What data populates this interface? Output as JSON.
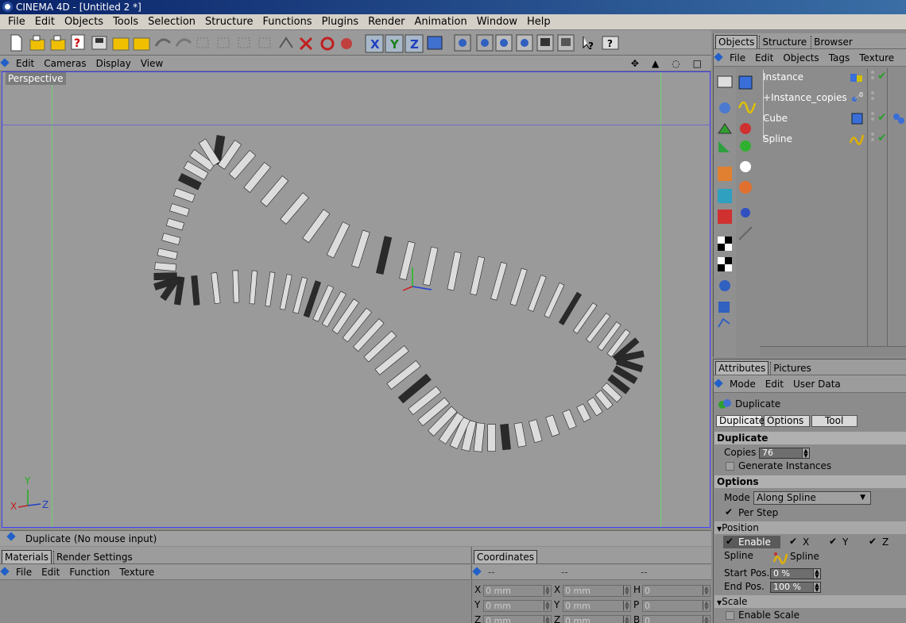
{
  "window": {
    "title": "CINEMA 4D - [Untitled 2 *]"
  },
  "menu": [
    "File",
    "Edit",
    "Objects",
    "Tools",
    "Selection",
    "Structure",
    "Functions",
    "Plugins",
    "Render",
    "Animation",
    "Window",
    "Help"
  ],
  "viewport": {
    "menu": [
      "Edit",
      "Cameras",
      "Display",
      "View"
    ],
    "label": "Perspective",
    "axis_labels": {
      "y": "Y",
      "x": "X",
      "z": "Z"
    }
  },
  "status": {
    "text": "Duplicate (No mouse input)"
  },
  "materials": {
    "tab_active": "Materials",
    "tab_other": "Render Settings",
    "menu": [
      "File",
      "Edit",
      "Function",
      "Texture"
    ]
  },
  "coordinates": {
    "tab": "Coordinates",
    "header": [
      "--",
      "--",
      "--"
    ],
    "rows": [
      {
        "a": "X",
        "av": "0 mm",
        "b": "X",
        "bv": "0 mm",
        "c": "H",
        "cv": "0"
      },
      {
        "a": "Y",
        "av": "0 mm",
        "b": "Y",
        "bv": "0 mm",
        "c": "P",
        "cv": "0"
      },
      {
        "a": "Z",
        "av": "0 mm",
        "b": "Z",
        "bv": "0 mm",
        "c": "B",
        "cv": "0"
      }
    ]
  },
  "objects_panel": {
    "tabs": {
      "active": "Objects",
      "t2": "Structure",
      "t3": "Browser"
    },
    "menu": [
      "File",
      "Edit",
      "Objects",
      "Tags",
      "Texture"
    ],
    "items": [
      {
        "name": "Instance",
        "prefix": "",
        "checked": true
      },
      {
        "name": "Instance_copies",
        "prefix": "+",
        "checked": false
      },
      {
        "name": "Cube",
        "prefix": "",
        "checked": true
      },
      {
        "name": "Spline",
        "prefix": "",
        "checked": true
      }
    ]
  },
  "attributes": {
    "tabs": {
      "active": "Attributes",
      "other": "Pictures"
    },
    "menu": [
      "Mode",
      "Edit",
      "User Data"
    ],
    "object_name": "Duplicate",
    "subtabs": [
      "Duplicate",
      "Options",
      "Tool"
    ],
    "sections": {
      "duplicate": "Duplicate",
      "options": "Options",
      "position": "Position",
      "scale": "Scale"
    },
    "copies_label": "Copies",
    "copies_value": "76",
    "generate_instances": "Generate Instances",
    "mode_label": "Mode",
    "mode_value": "Along Spline",
    "per_step": "Per Step",
    "enable": "Enable",
    "axes": [
      "X",
      "Y",
      "Z"
    ],
    "spline_label": "Spline",
    "spline_value": "Spline",
    "start_pos_label": "Start Pos.",
    "start_pos_value": "0 %",
    "end_pos_label": "End Pos.",
    "end_pos_value": "100 %",
    "enable_scale": "Enable Scale"
  },
  "colors": {
    "accent": "#0a246a",
    "viewport_border": "#4040ff",
    "grid_line": "#70d070"
  }
}
